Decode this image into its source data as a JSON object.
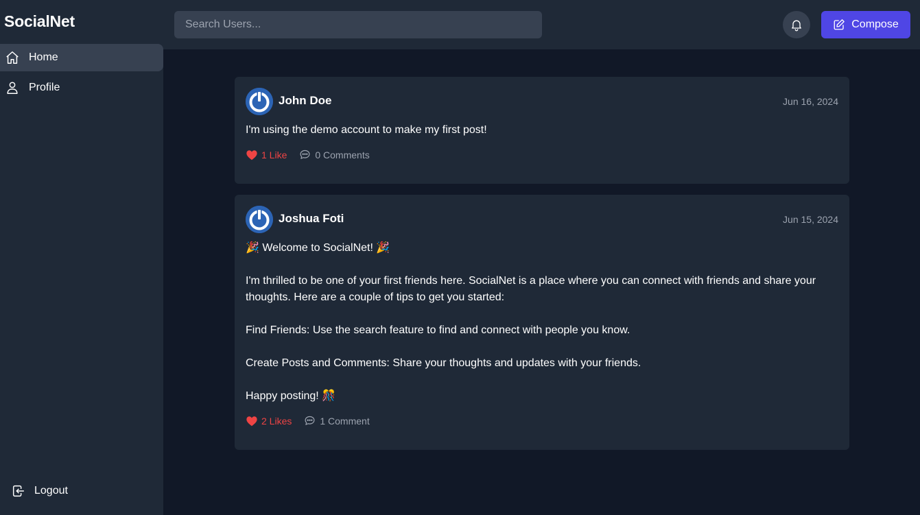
{
  "app": {
    "brand": "SocialNet"
  },
  "sidebar": {
    "items": [
      {
        "label": "Home",
        "icon": "home-icon",
        "active": true
      },
      {
        "label": "Profile",
        "icon": "user-icon",
        "active": false
      }
    ],
    "logout": {
      "label": "Logout",
      "icon": "logout-icon"
    }
  },
  "header": {
    "search_placeholder": "Search Users...",
    "bell_icon": "bell-icon",
    "compose_label": "Compose",
    "compose_icon": "pencil-square-icon"
  },
  "colors": {
    "background": "#111827",
    "panel": "#1f2937",
    "input": "#374151",
    "accent": "#4f46e5",
    "like": "#ef4444",
    "muted": "#9ca3af"
  },
  "posts": [
    {
      "author": "John Doe",
      "date": "Jun 16, 2024",
      "body": "I'm using the demo account to make my first post!",
      "likes_label": "1 Like",
      "comments_label": "0 Comments"
    },
    {
      "author": "Joshua Foti",
      "date": "Jun 15, 2024",
      "body": "🎉 Welcome to SocialNet! 🎉\n\nI'm thrilled to be one of your first friends here. SocialNet is a place where you can connect with friends and share your thoughts. Here are a couple of tips to get you started:\n\nFind Friends: Use the search feature to find and connect with people you know.\n\nCreate Posts and Comments: Share your thoughts and updates with your friends.\n\nHappy posting! 🎊",
      "likes_label": "2 Likes",
      "comments_label": "1 Comment"
    }
  ]
}
